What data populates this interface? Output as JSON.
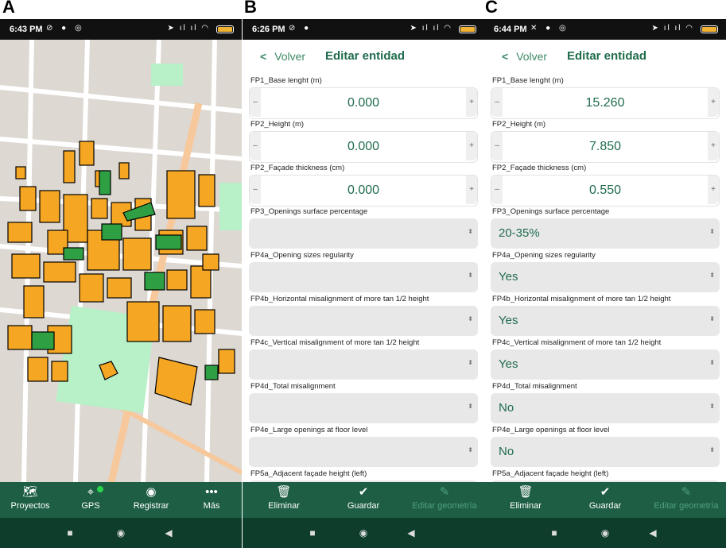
{
  "panels": [
    {
      "letter": "A",
      "status": {
        "time": "6:43 PM"
      },
      "nav": [
        {
          "label": "Proyectos",
          "icon": "map-icon"
        },
        {
          "label": "GPS",
          "icon": "gps-crosshair-icon"
        },
        {
          "label": "Registrar",
          "icon": "record-icon"
        },
        {
          "label": "Más",
          "icon": "more-icon"
        }
      ]
    },
    {
      "letter": "B",
      "status": {
        "time": "6:26 PM"
      },
      "header": {
        "back": "Volver",
        "title": "Editar entidad"
      },
      "fields": [
        {
          "label": "FP1_Base lenght (m)",
          "value": "0.000"
        },
        {
          "label": "FP2_Height (m)",
          "value": "0.000"
        },
        {
          "label": "FP2_Façade thickness (cm)",
          "value": "0.000"
        },
        {
          "label": "FP3_Openings surface percentage",
          "value": ""
        },
        {
          "label": "FP4a_Opening sizes regularity",
          "value": ""
        },
        {
          "label": "FP4b_Horizontal misalignment of more tan 1/2 height",
          "value": ""
        },
        {
          "label": "FP4c_Vertical misalignment of more tan 1/2 height",
          "value": ""
        },
        {
          "label": "FP4d_Total misalignment",
          "value": ""
        },
        {
          "label": "FP4e_Large openings at floor level",
          "value": ""
        },
        {
          "label": "FP5a_Adjacent façade height (left)",
          "value": ""
        }
      ],
      "nav": [
        {
          "label": "Eliminar",
          "icon": "trash-icon"
        },
        {
          "label": "Guardar",
          "icon": "check-icon"
        },
        {
          "label": "Editar geometría",
          "icon": "pencil-icon"
        }
      ]
    },
    {
      "letter": "C",
      "status": {
        "time": "6:44 PM"
      },
      "header": {
        "back": "Volver",
        "title": "Editar entidad"
      },
      "fields": [
        {
          "label": "FP1_Base lenght (m)",
          "value": "15.260"
        },
        {
          "label": "FP2_Height (m)",
          "value": "7.850"
        },
        {
          "label": "FP2_Façade thickness (cm)",
          "value": "0.550"
        },
        {
          "label": "FP3_Openings surface percentage",
          "value": "20-35%"
        },
        {
          "label": "FP4a_Opening sizes regularity",
          "value": "Yes"
        },
        {
          "label": "FP4b_Horizontal misalignment of more tan 1/2 height",
          "value": "Yes"
        },
        {
          "label": "FP4c_Vertical misalignment of more tan 1/2 height",
          "value": "Yes"
        },
        {
          "label": "FP4d_Total misalignment",
          "value": "No"
        },
        {
          "label": "FP4e_Large openings at floor level",
          "value": "No"
        },
        {
          "label": "FP5a_Adjacent façade height (left)",
          "value": ""
        }
      ],
      "nav": [
        {
          "label": "Eliminar",
          "icon": "trash-icon"
        },
        {
          "label": "Guardar",
          "icon": "check-icon"
        },
        {
          "label": "Editar geometría",
          "icon": "pencil-icon"
        }
      ]
    }
  ],
  "controls": {
    "minus": "–",
    "plus": "+"
  },
  "colors": {
    "accent": "#1f6b4c",
    "nav_bg": "#1d5e44",
    "building": "#f5a623",
    "building_selected": "#2ea043",
    "park": "#b8f0c8"
  }
}
